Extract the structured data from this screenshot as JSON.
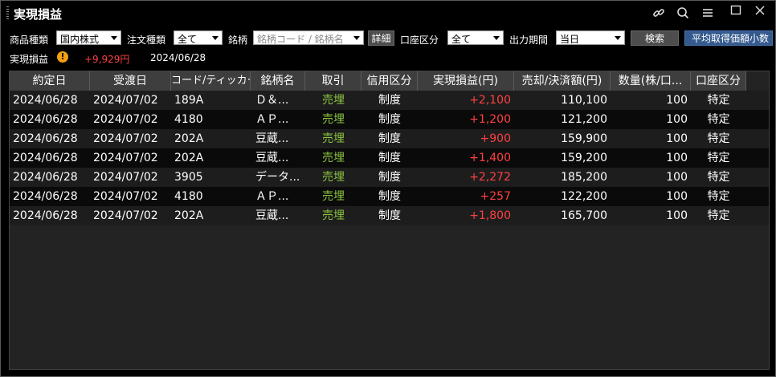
{
  "window": {
    "title": "実現損益"
  },
  "filters": {
    "product_label": "商品種類",
    "product_value": "国内株式",
    "order_type_label": "注文種類",
    "order_type_value": "全て",
    "symbol_label": "銘柄",
    "symbol_placeholder": "銘柄コード / 銘柄名",
    "detail_button": "詳細",
    "account_label": "口座区分",
    "account_value": "全て",
    "period_label": "出力期間",
    "period_value": "当日",
    "search_button": "検索",
    "avg_cost_button": "平均取得価額小数"
  },
  "summary": {
    "label": "実現損益",
    "value": "+9,929円",
    "date": "2024/06/28"
  },
  "table": {
    "headers": [
      "約定日",
      "受渡日",
      "コード/ティッカー",
      "銘柄名",
      "取引",
      "信用区分",
      "実現損益(円)",
      "売却/決済額(円)",
      "数量(株/口...",
      "口座区分"
    ],
    "rows": [
      [
        "2024/06/28",
        "2024/07/02",
        "189A",
        "Ｄ＆...",
        "売埋",
        "制度",
        "+2,100",
        "110,100",
        "100",
        "特定"
      ],
      [
        "2024/06/28",
        "2024/07/02",
        "4180",
        "ＡＰ...",
        "売埋",
        "制度",
        "+1,200",
        "121,200",
        "100",
        "特定"
      ],
      [
        "2024/06/28",
        "2024/07/02",
        "202A",
        "豆蔵...",
        "売埋",
        "制度",
        "+900",
        "159,900",
        "100",
        "特定"
      ],
      [
        "2024/06/28",
        "2024/07/02",
        "202A",
        "豆蔵...",
        "売埋",
        "制度",
        "+1,400",
        "159,200",
        "100",
        "特定"
      ],
      [
        "2024/06/28",
        "2024/07/02",
        "3905",
        "データ...",
        "売埋",
        "制度",
        "+2,272",
        "185,200",
        "100",
        "特定"
      ],
      [
        "2024/06/28",
        "2024/07/02",
        "4180",
        "ＡＰ...",
        "売埋",
        "制度",
        "+257",
        "122,200",
        "100",
        "特定"
      ],
      [
        "2024/06/28",
        "2024/07/02",
        "202A",
        "豆蔵...",
        "売埋",
        "制度",
        "+1,800",
        "165,700",
        "100",
        "特定"
      ]
    ]
  },
  "colors": {
    "profit": "#ff4040",
    "sell": "#8cc63f",
    "accent_button": "#345a8e"
  },
  "icons": [
    "link-icon",
    "search-icon",
    "menu-icon",
    "maximize-icon",
    "close-icon",
    "warning-icon"
  ]
}
